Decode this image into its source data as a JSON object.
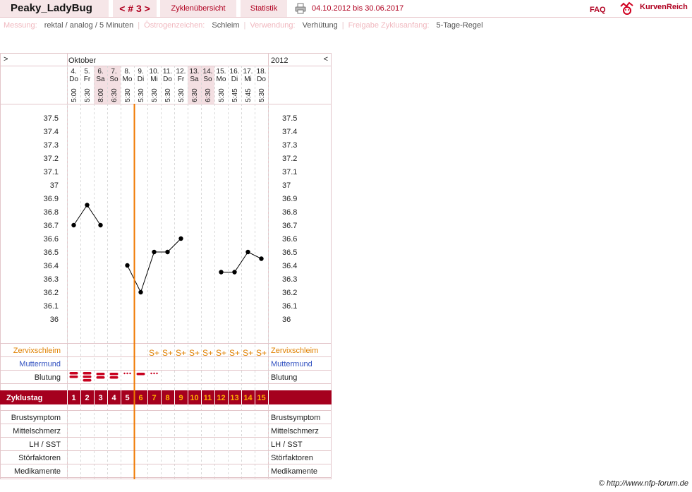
{
  "header": {
    "user": "Peaky_LadyBug",
    "cycle_nav": "< # 3 >",
    "tab_overview": "Zyklenübersicht",
    "tab_stats": "Statistik",
    "date_range": "04.10.2012 bis 30.06.2017",
    "faq": "FAQ",
    "brand": "KurvenReich"
  },
  "meta": [
    {
      "key": "Messung:",
      "value": "rektal / analog / 5 Minuten"
    },
    {
      "key": "Östrogenzeichen:",
      "value": "Schleim"
    },
    {
      "key": "Verwendung:",
      "value": "Verhütung"
    },
    {
      "key": "Freigabe Zyklusanfang:",
      "value": "5-Tage-Regel"
    }
  ],
  "table": {
    "nav_left": ">",
    "nav_right": "<",
    "month": "Oktober",
    "year": "2012",
    "row_labels": {
      "cervix": "Zervixschleim",
      "cervix_pos": "Muttermund",
      "bleeding": "Blutung",
      "cycle_day": "Zyklustag",
      "breast": "Brustsymptom",
      "midpain": "Mittelschmerz",
      "lh": "LH / SST",
      "disturb": "Störfaktoren",
      "meds": "Medikamente"
    },
    "weekend_color": "#f3dfe2",
    "accent_color": "#a5001e",
    "coverline_color": "#f07800"
  },
  "chart_data": {
    "type": "line",
    "x": [
      "4.",
      "5.",
      "6.",
      "7.",
      "8.",
      "9.",
      "10.",
      "11.",
      "12.",
      "13.",
      "14.",
      "15.",
      "16.",
      "17.",
      "18."
    ],
    "weekdays": [
      "Do",
      "Fr",
      "Sa",
      "So",
      "Mo",
      "Di",
      "Mi",
      "Do",
      "Fr",
      "Sa",
      "So",
      "Mo",
      "Di",
      "Mi",
      "Do"
    ],
    "times": [
      "5:00",
      "5:30",
      "8:00",
      "6:30",
      "5:30",
      "5:30",
      "5:30",
      "5:30",
      "5:30",
      "6:30",
      "6:30",
      "5:30",
      "5:45",
      "5:45",
      "5:30"
    ],
    "weekend": [
      false,
      false,
      true,
      true,
      false,
      false,
      false,
      false,
      false,
      true,
      true,
      false,
      false,
      false,
      false
    ],
    "series": [
      {
        "values": [
          36.7,
          36.85,
          36.7,
          null,
          36.4,
          36.2,
          36.5,
          36.5,
          36.6,
          null,
          null,
          36.35,
          36.35,
          36.5,
          36.45
        ]
      }
    ],
    "segments": [
      [
        0,
        2
      ],
      [
        4,
        8
      ],
      [
        11,
        14
      ]
    ],
    "yticks": [
      "37.5",
      "37.4",
      "37.3",
      "37.2",
      "37.1",
      "37",
      "36.9",
      "36.8",
      "36.7",
      "36.6",
      "36.5",
      "36.4",
      "36.3",
      "36.2",
      "36.1",
      "36"
    ],
    "ylim": [
      36.0,
      37.5
    ],
    "cervix_symbol": "S+",
    "cervix_marks": [
      false,
      false,
      false,
      false,
      false,
      false,
      true,
      true,
      true,
      true,
      true,
      true,
      true,
      true,
      true
    ],
    "bleeding": [
      3,
      3,
      2,
      2,
      1,
      2,
      1,
      0,
      0,
      0,
      0,
      0,
      0,
      0,
      0
    ],
    "cycle_days": [
      "1",
      "2",
      "3",
      "4",
      "5",
      "6",
      "7",
      "8",
      "9",
      "10",
      "11",
      "12",
      "13",
      "14",
      "15"
    ],
    "marker_after_index": 4
  },
  "footer": {
    "copyright": "© http://www.nfp-forum.de"
  }
}
